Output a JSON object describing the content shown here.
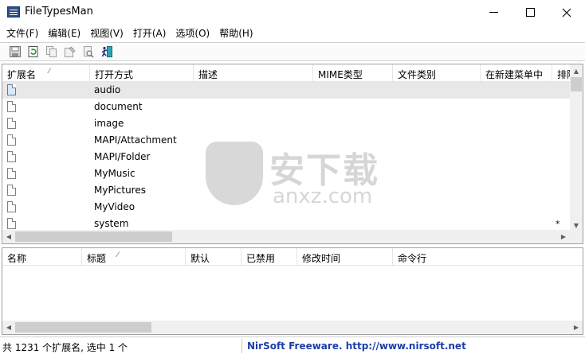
{
  "window": {
    "title": "FileTypesMan"
  },
  "menu": [
    "文件(F)",
    "编辑(E)",
    "视图(V)",
    "打开(A)",
    "选项(O)",
    "帮助(H)"
  ],
  "toolbar": {
    "buttons": [
      "save-icon",
      "refresh-icon",
      "copy-icon",
      "properties-icon",
      "find-icon",
      "exit-icon"
    ]
  },
  "top_table": {
    "columns": [
      "扩展名",
      "打开方式",
      "描述",
      "MIME类型",
      "文件类别",
      "在新建菜单中",
      "排除"
    ],
    "sort_indicator": "⁄",
    "rows": [
      {
        "name": "audio",
        "star": ""
      },
      {
        "name": "document",
        "star": ""
      },
      {
        "name": "image",
        "star": ""
      },
      {
        "name": "MAPI/Attachment",
        "star": ""
      },
      {
        "name": "MAPI/Folder",
        "star": ""
      },
      {
        "name": "MyMusic",
        "star": ""
      },
      {
        "name": "MyPictures",
        "star": ""
      },
      {
        "name": "MyVideo",
        "star": ""
      },
      {
        "name": "system",
        "star": "*"
      }
    ]
  },
  "bottom_table": {
    "columns": [
      "名称",
      "标题",
      "默认",
      "已禁用",
      "修改时间",
      "命令行"
    ],
    "sort_indicator": "⁄"
  },
  "watermark": {
    "cn": "安下载",
    "en": "anxz.com"
  },
  "status": {
    "left": "共 1231 个扩展名, 选中 1 个",
    "right": "NirSoft Freeware.  http://www.nirsoft.net"
  },
  "colors": {
    "link": "#1c3ea8",
    "selected_row": "#e8e8e8"
  }
}
